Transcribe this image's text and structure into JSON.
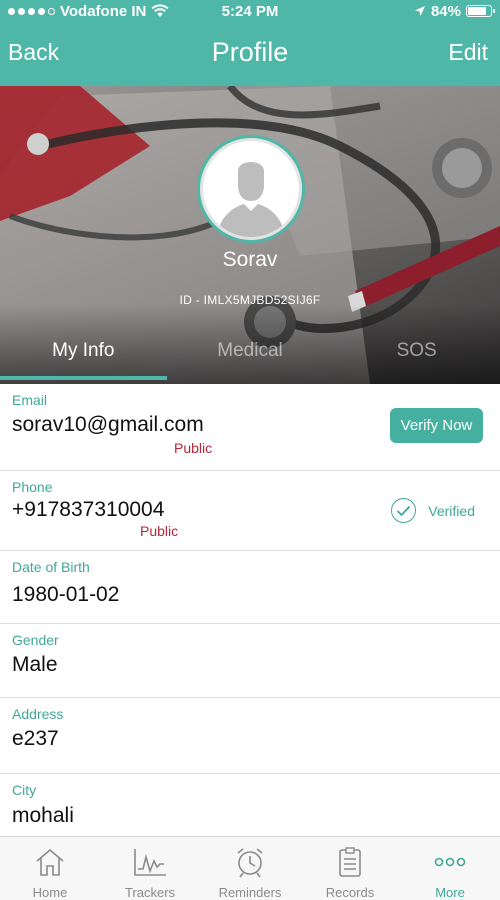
{
  "status_bar": {
    "carrier": "Vodafone IN",
    "time": "5:24 PM",
    "battery": "84%",
    "battery_level": 0.84,
    "icons": [
      "signal-dots-icon",
      "wifi-icon",
      "location-arrow-icon",
      "battery-icon"
    ]
  },
  "nav": {
    "back_label": "Back",
    "title": "Profile",
    "edit_label": "Edit"
  },
  "profile": {
    "name": "Sorav",
    "id_text": "ID - IMLX5MJBD52SIJ6F"
  },
  "tabs": [
    {
      "label": "My Info",
      "active": true
    },
    {
      "label": "Medical",
      "active": false
    },
    {
      "label": "SOS",
      "active": false
    }
  ],
  "fields": {
    "email": {
      "label": "Email",
      "value": "sorav10@gmail.com",
      "privacy": "Public",
      "action": "Verify Now"
    },
    "phone": {
      "label": "Phone",
      "value": "+917837310004",
      "privacy": "Public",
      "status": "Verified"
    },
    "dob": {
      "label": "Date of Birth",
      "value": "1980-01-02"
    },
    "gender": {
      "label": "Gender",
      "value": "Male"
    },
    "address": {
      "label": "Address",
      "value": "e237"
    },
    "city": {
      "label": "City",
      "value": "mohali"
    }
  },
  "tabbar": [
    {
      "label": "Home",
      "icon": "home-icon",
      "active": false
    },
    {
      "label": "Trackers",
      "icon": "chart-icon",
      "active": false
    },
    {
      "label": "Reminders",
      "icon": "alarm-clock-icon",
      "active": false
    },
    {
      "label": "Records",
      "icon": "clipboard-icon",
      "active": false
    },
    {
      "label": "More",
      "icon": "more-dots-icon",
      "active": true
    }
  ],
  "colors": {
    "accent": "#4fb7a8",
    "privacy": "#b5253c",
    "label": "#3fa898"
  }
}
